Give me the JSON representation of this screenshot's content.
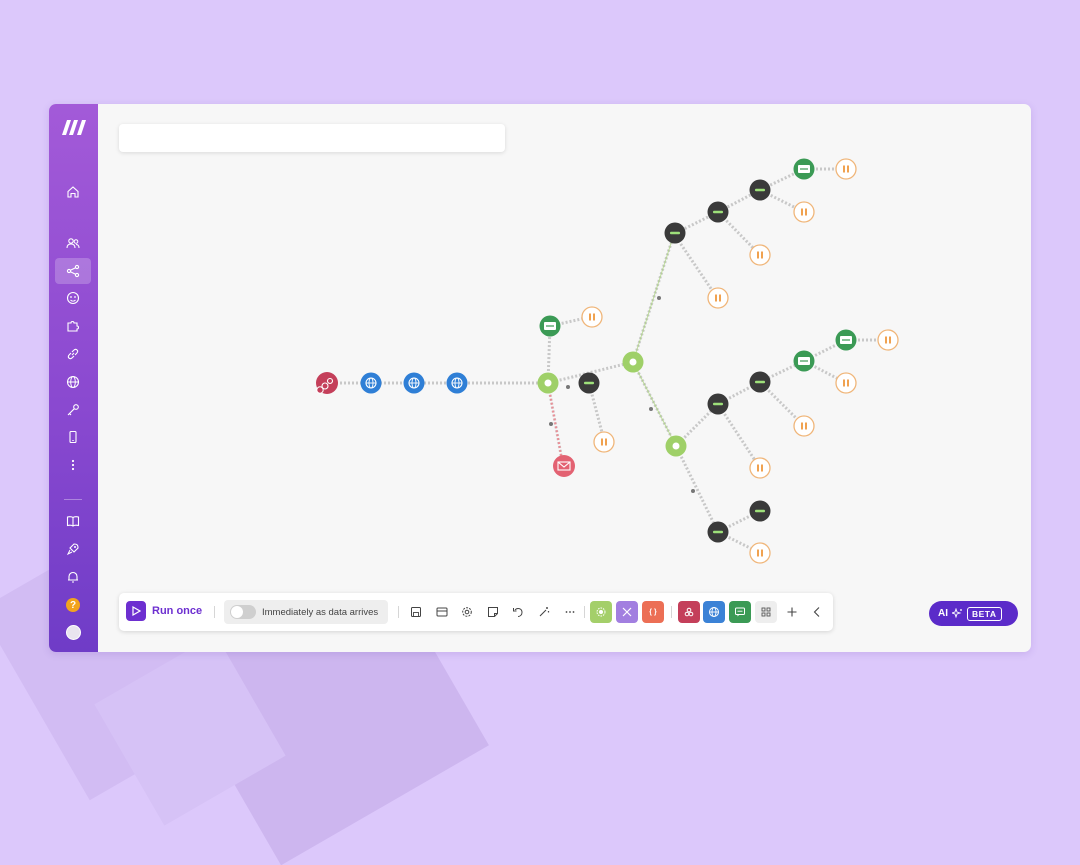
{
  "app": {
    "scenario_title": ""
  },
  "sidebar": {
    "items": [
      {
        "name": "home-icon"
      },
      {
        "name": "team-icon"
      },
      {
        "name": "scenarios-icon",
        "active": true
      },
      {
        "name": "templates-icon"
      },
      {
        "name": "apps-icon"
      },
      {
        "name": "connections-icon"
      },
      {
        "name": "webhooks-icon"
      },
      {
        "name": "keys-icon"
      },
      {
        "name": "devices-icon"
      },
      {
        "name": "more-icon"
      }
    ],
    "bottom_items": [
      {
        "name": "docs-icon"
      },
      {
        "name": "rocket-icon"
      },
      {
        "name": "notifications-icon"
      }
    ],
    "help_label": "?"
  },
  "toolbar": {
    "run_once_label": "Run once",
    "immediately_label": "Immediately as data arrives",
    "icons": [
      "save-icon",
      "scheduling-icon",
      "settings-icon",
      "notes-icon",
      "undo-icon",
      "auto-align-icon",
      "more-dots-icon"
    ],
    "tool_tiles": [
      {
        "name": "tools-tile",
        "color": "#a4cf6a"
      },
      {
        "name": "flow-control-tile",
        "color": "#a27fe0"
      },
      {
        "name": "json-tile",
        "color": "#ec6f55",
        "text": "{ }"
      }
    ],
    "module_tiles": [
      {
        "name": "webhooks-tile",
        "color": "#c43f5a"
      },
      {
        "name": "http-tile",
        "color": "#3b82d6"
      },
      {
        "name": "textlocal-tile",
        "color": "#3b9a55"
      }
    ]
  },
  "ai_button": {
    "label": "AI",
    "badge": "BETA"
  },
  "colors": {
    "accent": "#6d2fd0",
    "sidebar_top": "#a35ad8",
    "sidebar_bottom": "#6f3cc7",
    "webhook": "#c43f5a",
    "http": "#2f7fd6",
    "router": "#9fd068",
    "dark_module": "#3a3a3a",
    "sms": "#3b9a55",
    "email": "#e36272",
    "break": "#f0a250"
  }
}
